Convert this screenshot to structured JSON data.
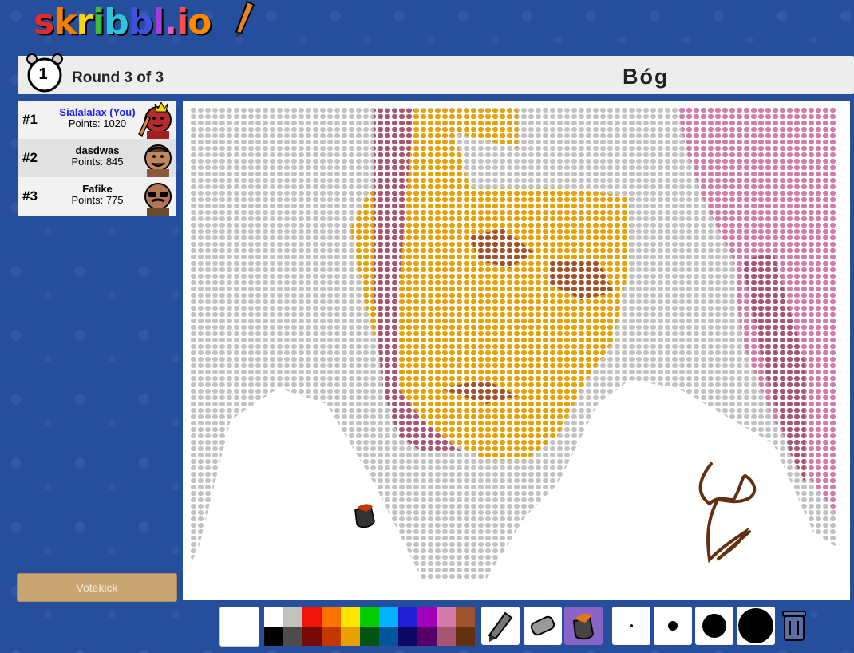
{
  "logo": {
    "text_chars": [
      "s",
      "k",
      "r",
      "i",
      "b",
      "b",
      "l",
      ".",
      "i",
      "o"
    ],
    "colors": [
      "#e52b2b",
      "#f77f00",
      "#ffd500",
      "#3dbd3d",
      "#2ec4d9",
      "#3f51e0",
      "#a33ddb",
      "#ea5ac5",
      "#ff4d4d",
      "#ff8800"
    ]
  },
  "header": {
    "round_number": "1",
    "round_text": "Round 3 of 3",
    "word": "Bóg"
  },
  "players": [
    {
      "rank": "#1",
      "name": "Sialalalax (You)",
      "points": "Points: 1020",
      "is_me": true,
      "drawing": true,
      "crown": true
    },
    {
      "rank": "#2",
      "name": "dasdwas",
      "points": "Points: 845",
      "is_me": false
    },
    {
      "rank": "#3",
      "name": "Fafike",
      "points": "Points: 775",
      "is_me": false
    }
  ],
  "votekick_label": "Votekick",
  "palette": {
    "top": [
      "#ffffff",
      "#c1c1c1",
      "#ef130b",
      "#ff7100",
      "#ffe400",
      "#00cc00",
      "#00b2ff",
      "#231fd3",
      "#a300ba",
      "#d37caa",
      "#a0522d"
    ],
    "bottom": [
      "#000000",
      "#4c4c4c",
      "#740b07",
      "#c23800",
      "#e8a200",
      "#005510",
      "#00569e",
      "#0e0865",
      "#550069",
      "#a75574",
      "#63300d"
    ]
  },
  "tools": [
    "pencil-icon",
    "eraser-icon",
    "fill-icon"
  ],
  "active_tool": "fill-icon",
  "brush_sizes": [
    "small",
    "medium",
    "large",
    "xlarge"
  ],
  "colors": {
    "background": "#254f9c",
    "topbar": "#ededed",
    "votekick": "#c9a572",
    "active_tool": "#8a63c7"
  }
}
